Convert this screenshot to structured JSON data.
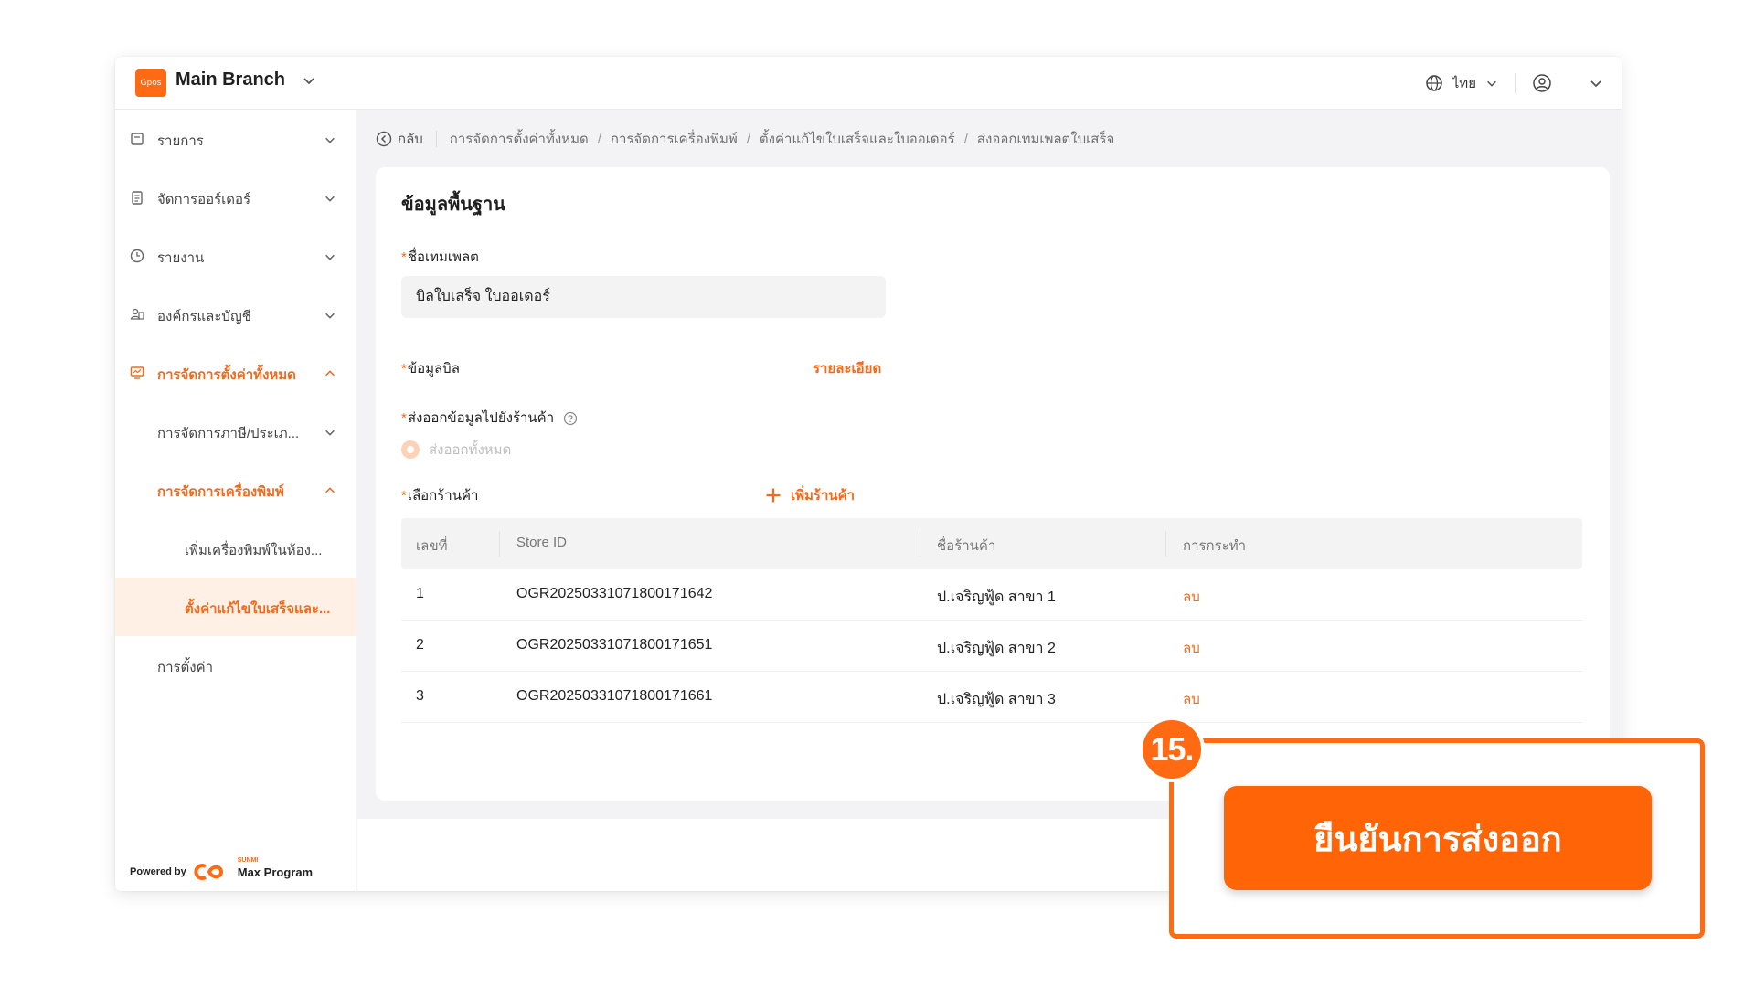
{
  "header": {
    "logo_text": "Gpos",
    "branch_name": "Main Branch",
    "language": "ไทย"
  },
  "sidebar": {
    "items": [
      {
        "label": "รายการ"
      },
      {
        "label": "จัดการออร์เดอร์"
      },
      {
        "label": "รายงาน"
      },
      {
        "label": "องค์กรและบัญชี"
      },
      {
        "label": "การจัดการตั้งค่าทั้งหมด"
      },
      {
        "label": "การจัดการภาษี/ประเภ..."
      },
      {
        "label": "การจัดการเครื่องพิมพ์"
      },
      {
        "label": "เพิ่มเครื่องพิมพ์ในห้อง..."
      },
      {
        "label": "ตั้งค่าแก้ไขใบเสร็จและ..."
      },
      {
        "label": "การตั้งค่า"
      }
    ],
    "powered_by": "Powered by",
    "brand_small": "SUNMI",
    "brand_name": "Max Program"
  },
  "breadcrumb": {
    "back": "กลับ",
    "items": [
      "การจัดการตั้งค่าทั้งหมด",
      "การจัดการเครื่องพิมพ์",
      "ตั้งค่าแก้ไขใบเสร็จและใบออเดอร์",
      "ส่งออกเทมเพลตใบเสร็จ"
    ],
    "separator": "/"
  },
  "form": {
    "section_title": "ข้อมูลพื้นฐาน",
    "template_name_label": "ชื่อเทมเพลต",
    "template_name_value": "บิลใบเสร็จ ใบออเดอร์",
    "bill_info_label": "ข้อมูลบิล",
    "bill_info_link": "รายละเอียด",
    "export_label": "ส่งออกข้อมูลไปยังร้านค้า",
    "export_option": "ส่งออกทั้งหมด",
    "select_store_label": "เลือกร้านค้า",
    "add_store": "เพิ่มร้านค้า",
    "required_mark": "*"
  },
  "table": {
    "columns": [
      "เลขที่",
      "Store ID",
      "ชื่อร้านค้า",
      "การกระทำ"
    ],
    "rows": [
      {
        "no": "1",
        "store_id": "OGR20250331071800171642",
        "name": "ป.เจริญฟู้ด สาขา 1",
        "action": "ลบ"
      },
      {
        "no": "2",
        "store_id": "OGR20250331071800171651",
        "name": "ป.เจริญฟู้ด สาขา 2",
        "action": "ลบ"
      },
      {
        "no": "3",
        "store_id": "OGR20250331071800171661",
        "name": "ป.เจริญฟู้ด สาขา 3",
        "action": "ลบ"
      }
    ]
  },
  "callout": {
    "step": "15.",
    "confirm_label": "ยืนยันการส่งออก"
  },
  "colors": {
    "accent": "#ff6a13",
    "sidebar_active_bg": "#fff0e6",
    "background": "#f3f3f5"
  }
}
